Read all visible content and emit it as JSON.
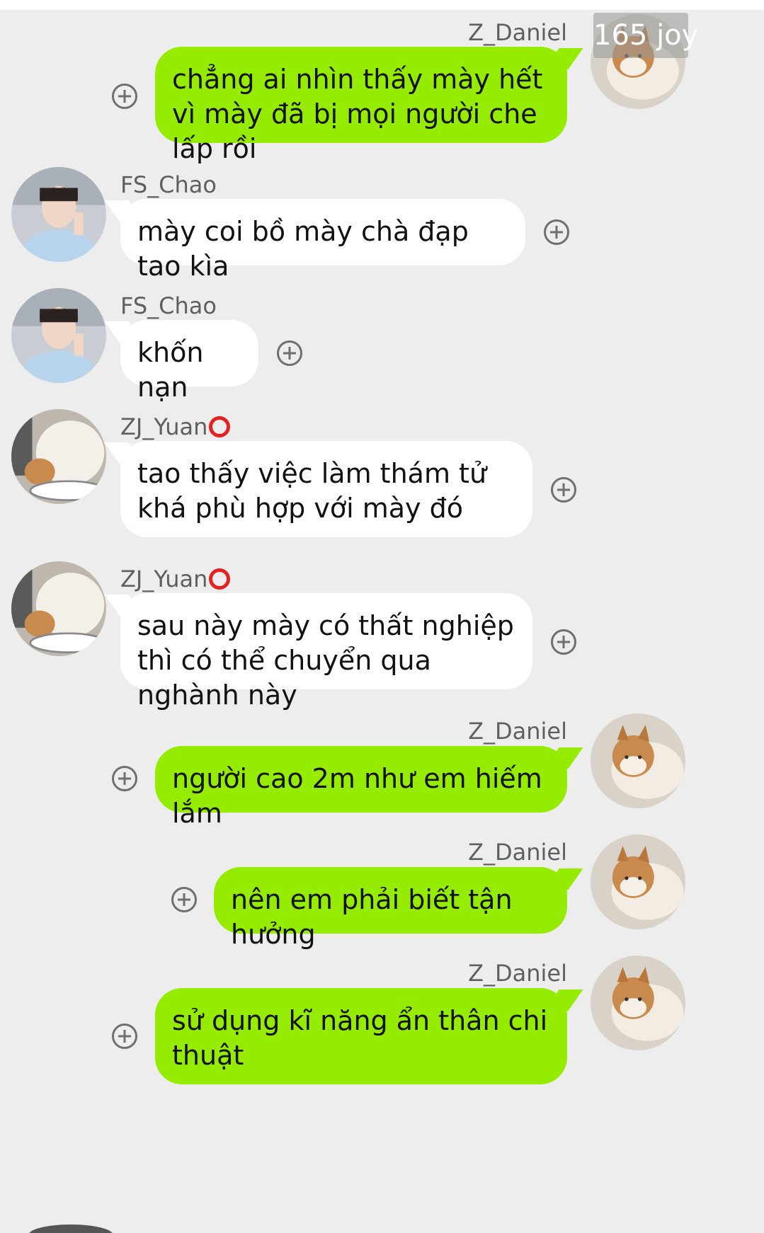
{
  "colors": {
    "background": "#ededed",
    "outgoing_bubble": "#95ec00",
    "incoming_bubble": "#ffffff",
    "sender_name": "#5f5f5f",
    "status_ring": "#e62020"
  },
  "badge": {
    "text": "165 joy"
  },
  "messages": [
    {
      "sender": "Z_Daniel",
      "text": "chẳng ai nhìn thấy mày hết vì mày đã bị mọi người che lấp rồi",
      "direction": "outgoing",
      "avatar_icon": "cat-avatar-icon"
    },
    {
      "sender": "FS_Chao",
      "text": "mày coi bồ mày chà đạp tao kìa",
      "direction": "incoming",
      "avatar_icon": "person-avatar-icon"
    },
    {
      "sender": "FS_Chao",
      "text": "khốn nạn",
      "direction": "incoming",
      "avatar_icon": "person-avatar-icon"
    },
    {
      "sender": "ZJ_Yuan",
      "text": " tao thấy việc làm thám tử khá phù hợp với mày đó",
      "direction": "incoming",
      "avatar_icon": "cat-avatar-icon"
    },
    {
      "sender": "ZJ_Yuan",
      "text": "sau này mày có thất nghiệp thì có thể chuyển qua nghành này",
      "direction": "incoming",
      "avatar_icon": "cat-avatar-icon"
    },
    {
      "sender": "Z_Daniel",
      "text": "người cao 2m như em hiếm lắm",
      "direction": "outgoing",
      "avatar_icon": "cat-avatar-icon"
    },
    {
      "sender": "Z_Daniel",
      "text": "nên em phải biết tận hưởng",
      "direction": "outgoing",
      "avatar_icon": "cat-avatar-icon"
    },
    {
      "sender": "Z_Daniel",
      "text": "sử dụng kĩ năng ẩn thân chi thuật",
      "direction": "outgoing",
      "avatar_icon": "cat-avatar-icon"
    }
  ]
}
